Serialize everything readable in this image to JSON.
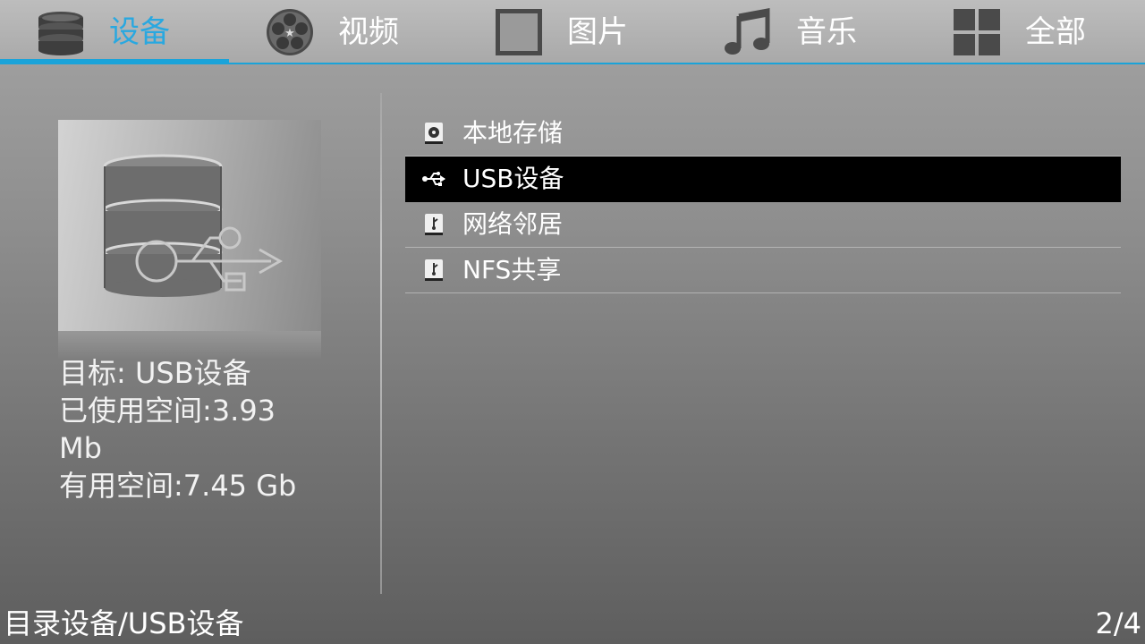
{
  "tabs": [
    {
      "label": "设备",
      "icon": "database-icon",
      "active": true
    },
    {
      "label": "视频",
      "icon": "film-reel-icon",
      "active": false
    },
    {
      "label": "图片",
      "icon": "picture-frame-icon",
      "active": false
    },
    {
      "label": "音乐",
      "icon": "music-note-icon",
      "active": false
    },
    {
      "label": "全部",
      "icon": "grid-icon",
      "active": false
    }
  ],
  "accent_color": "#1aa3d9",
  "preview": {
    "icon": "usb-database-icon"
  },
  "info": {
    "target": "目标: USB设备",
    "used_space": "已使用空间:3.93 Mb",
    "free_space": "有用空间:7.45 Gb"
  },
  "list": {
    "items": [
      {
        "label": "本地存储",
        "icon": "hard-disk-icon",
        "selected": false
      },
      {
        "label": "USB设备",
        "icon": "usb-icon",
        "selected": true
      },
      {
        "label": "网络邻居",
        "icon": "network-drive-icon",
        "selected": false
      },
      {
        "label": "NFS共享",
        "icon": "network-drive-icon",
        "selected": false
      }
    ]
  },
  "footer": {
    "path": "目录设备/USB设备",
    "page": "2/4"
  }
}
